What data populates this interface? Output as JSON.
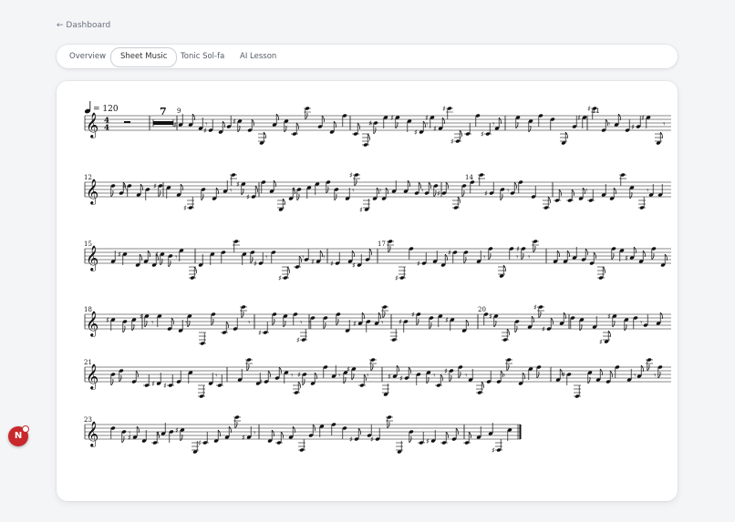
{
  "nav": {
    "back_label": "← Dashboard"
  },
  "tabs": [
    {
      "label": "Overview",
      "active": false
    },
    {
      "label": "Sheet Music",
      "active": true
    },
    {
      "label": "Tonic Sol-fa",
      "active": false
    },
    {
      "label": "AI Lesson",
      "active": false
    }
  ],
  "score": {
    "tempo_marking": "= 120",
    "time_signature": {
      "top": "4",
      "bottom": "4"
    },
    "multirest_count": "7",
    "measure_numbers": [
      "9",
      "11",
      "12",
      "14",
      "15",
      "17",
      "18",
      "20",
      "21",
      "23"
    ]
  },
  "fab": {
    "label": "N"
  },
  "colors": {
    "accent": "#c8282b",
    "ink": "#111111"
  }
}
